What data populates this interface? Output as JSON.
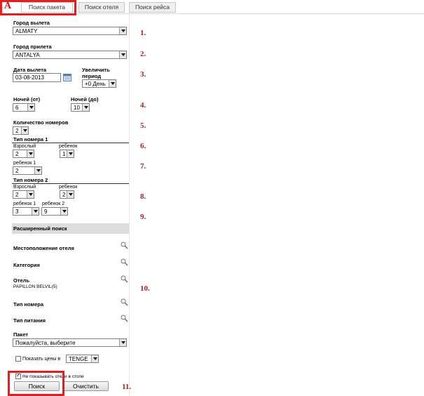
{
  "tabs": [
    {
      "label": "Поиск пакета",
      "active": true
    },
    {
      "label": "Поиск отеля",
      "active": false
    },
    {
      "label": "Поиск рейса",
      "active": false
    }
  ],
  "logo_letter": "A",
  "departure_city": {
    "label": "Город вылета",
    "value": "ALMATY"
  },
  "arrival_city": {
    "label": "Город прилета",
    "value": "ANTALYA"
  },
  "departure_date": {
    "label": "Дата вылета",
    "value": "03-08-2013"
  },
  "extend_period": {
    "label_line1": "Увеличить",
    "label_line2": "период",
    "value": "+0 День"
  },
  "nights_from": {
    "label": "Ночей (от)",
    "value": "6"
  },
  "nights_to": {
    "label": "Ночей (до)",
    "value": "10"
  },
  "rooms_count": {
    "label": "Количество номеров",
    "value": "2"
  },
  "room1": {
    "title": "Тип номера 1",
    "adult_label": "Взрослый",
    "adult_value": "2",
    "child_label": "ребенок",
    "child_value": "1",
    "child1_label": "ребенок 1",
    "child1_value": "2"
  },
  "room2": {
    "title": "Тип номера 2",
    "adult_label": "Взрослый",
    "adult_value": "2",
    "child_label": "ребенок",
    "child_value": "2",
    "child1_label": "ребенок 1",
    "child1_value": "3",
    "child2_label": "ребенок 2",
    "child2_value": "9"
  },
  "advanced": {
    "title": "Расширенный поиск",
    "hotel_location": "Местоположение отеля",
    "category": "Категория",
    "hotel": "Отель",
    "hotel_value": "PAPILLON BELVIL(5)",
    "room_type": "Тип номера",
    "meal_type": "Тип питания",
    "package_label": "Пакет",
    "package_value": "Пожалуйста, выберите"
  },
  "show_prices": {
    "label": "Показать цены в",
    "currency": "TENGE",
    "checked": false
  },
  "hide_stop": {
    "label": "Не показывать отели в стопе",
    "checked": true
  },
  "buttons": {
    "search": "Поиск",
    "clear": "Очистить"
  },
  "row_numbers": [
    "1.",
    "2.",
    "3.",
    "4.",
    "5.",
    "6.",
    "7.",
    "8.",
    "9.",
    "10.",
    "11."
  ],
  "colors": {
    "highlight": "#e02020",
    "number": "#b02020",
    "section": "#dcdcdc"
  }
}
